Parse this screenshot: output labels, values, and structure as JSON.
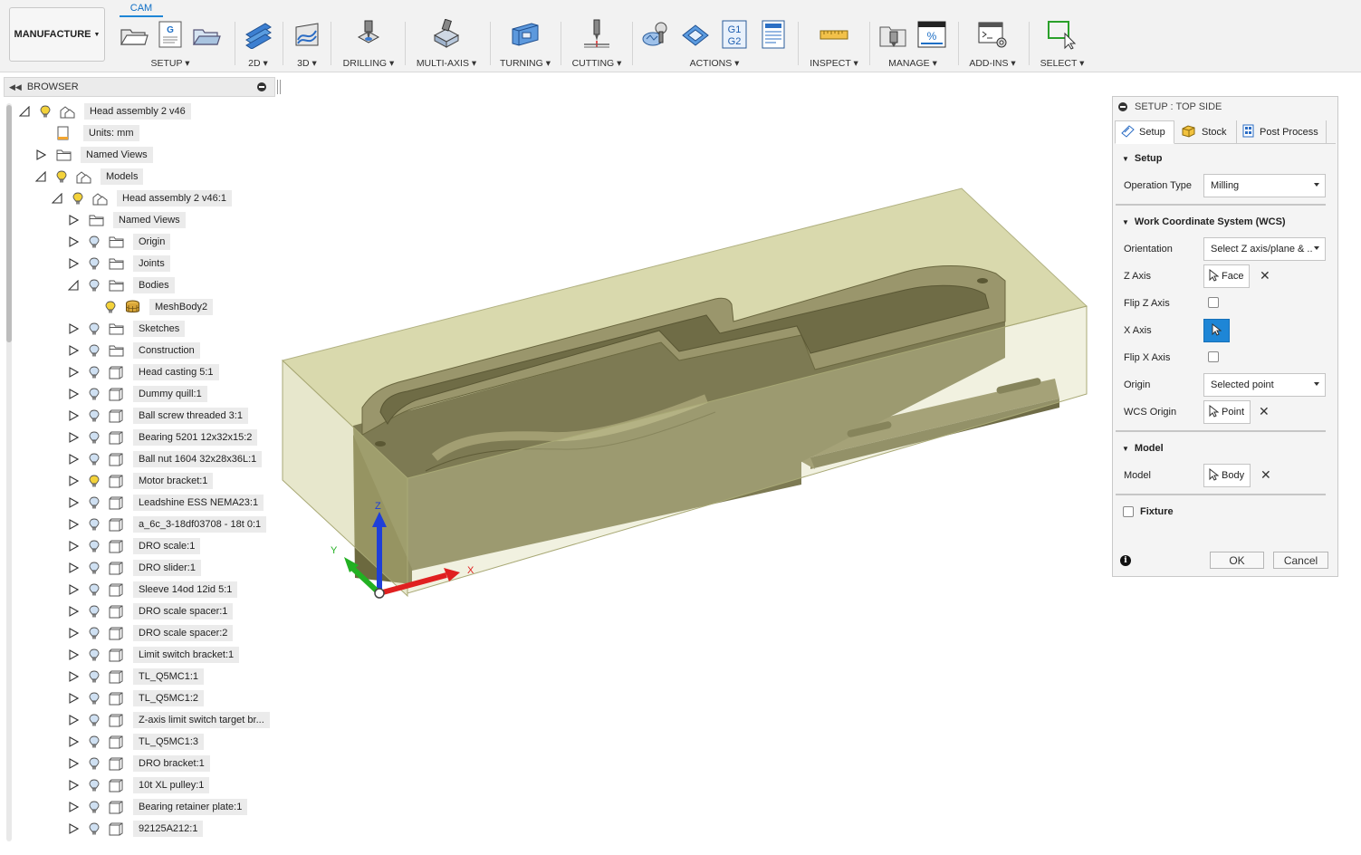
{
  "toolbar": {
    "active_tab": "CAM",
    "workspace": "MANUFACTURE",
    "groups": [
      {
        "label": "SETUP"
      },
      {
        "label": "2D"
      },
      {
        "label": "3D"
      },
      {
        "label": "DRILLING"
      },
      {
        "label": "MULTI-AXIS"
      },
      {
        "label": "TURNING"
      },
      {
        "label": "CUTTING"
      },
      {
        "label": "ACTIONS"
      },
      {
        "label": "INSPECT"
      },
      {
        "label": "MANAGE"
      },
      {
        "label": "ADD-INS"
      },
      {
        "label": "SELECT"
      }
    ],
    "actions_g1g2": "G1G2"
  },
  "browser": {
    "title": "BROWSER",
    "items": [
      {
        "label": "Head assembly 2 v46"
      },
      {
        "label": "Units: mm"
      },
      {
        "label": "Named Views"
      },
      {
        "label": "Models"
      },
      {
        "label": "Head assembly 2 v46:1"
      },
      {
        "label": "Named Views"
      },
      {
        "label": "Origin"
      },
      {
        "label": "Joints"
      },
      {
        "label": "Bodies"
      },
      {
        "label": "MeshBody2"
      },
      {
        "label": "Sketches"
      },
      {
        "label": "Construction"
      },
      {
        "label": "Head casting 5:1"
      },
      {
        "label": "Dummy quill:1"
      },
      {
        "label": "Ball screw threaded 3:1"
      },
      {
        "label": "Bearing 5201 12x32x15:2"
      },
      {
        "label": "Ball nut 1604 32x28x36L:1"
      },
      {
        "label": "Motor bracket:1"
      },
      {
        "label": "Leadshine ESS NEMA23:1"
      },
      {
        "label": "a_6c_3-18df03708 - 18t 0:1"
      },
      {
        "label": "DRO scale:1"
      },
      {
        "label": "DRO slider:1"
      },
      {
        "label": "Sleeve 14od 12id 5:1"
      },
      {
        "label": "DRO scale spacer:1"
      },
      {
        "label": "DRO scale spacer:2"
      },
      {
        "label": "Limit switch bracket:1"
      },
      {
        "label": "TL_Q5MC1:1"
      },
      {
        "label": "TL_Q5MC1:2"
      },
      {
        "label": "Z-axis limit switch target br..."
      },
      {
        "label": "TL_Q5MC1:3"
      },
      {
        "label": "DRO bracket:1"
      },
      {
        "label": "10t XL pulley:1"
      },
      {
        "label": "Bearing retainer plate:1"
      },
      {
        "label": "92125A212:1"
      }
    ]
  },
  "viewport": {
    "axis_x": "X",
    "axis_y": "Y",
    "axis_z": "Z"
  },
  "panel": {
    "title": "SETUP : TOP SIDE",
    "tabs": [
      {
        "label": "Setup"
      },
      {
        "label": "Stock"
      },
      {
        "label": "Post Process"
      }
    ],
    "setup_section": "Setup",
    "operation_type_label": "Operation Type",
    "operation_type_value": "Milling",
    "wcs_section": "Work Coordinate System (WCS)",
    "orientation_label": "Orientation",
    "orientation_value": "Select Z axis/plane & ...",
    "z_axis_label": "Z Axis",
    "z_axis_value": "Face",
    "flip_z_label": "Flip Z Axis",
    "x_axis_label": "X Axis",
    "flip_x_label": "Flip X Axis",
    "origin_label": "Origin",
    "origin_value": "Selected point",
    "wcs_origin_label": "WCS Origin",
    "wcs_origin_value": "Point",
    "model_section": "Model",
    "model_label": "Model",
    "model_value": "Body",
    "fixture_label": "Fixture",
    "ok_label": "OK",
    "cancel_label": "Cancel"
  },
  "colors": {
    "accent": "#1e86d6",
    "stock": "#cfcf9a",
    "part": "#7a7650",
    "x_axis": "#e02020",
    "y_axis": "#22b022",
    "z_axis": "#1f3fd8"
  }
}
